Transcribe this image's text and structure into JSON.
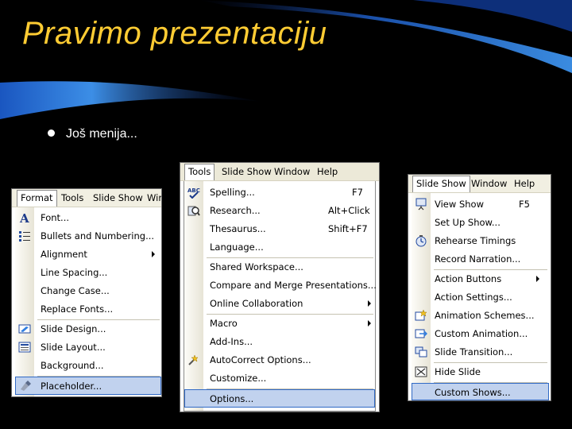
{
  "slide": {
    "title": "Pravimo prezentaciju",
    "bullet": "Još menija..."
  },
  "format_menu": {
    "menubar": [
      "Format",
      "Tools",
      "Slide Show",
      "Win"
    ],
    "items": [
      {
        "label": "Font...",
        "icon": "font-icon"
      },
      {
        "label": "Bullets and Numbering...",
        "icon": "bullets-icon"
      },
      {
        "label": "Alignment",
        "submenu": true
      },
      {
        "label": "Line Spacing..."
      },
      {
        "label": "Change Case..."
      },
      {
        "label": "Replace Fonts..."
      },
      {
        "label": "Slide Design...",
        "icon": "slide-design-icon"
      },
      {
        "label": "Slide Layout...",
        "icon": "slide-layout-icon"
      },
      {
        "label": "Background..."
      },
      {
        "label": "Placeholder...",
        "icon": "placeholder-icon",
        "highlighted": true
      }
    ]
  },
  "tools_menu": {
    "menubar": [
      "Tools",
      "Slide Show",
      "Window",
      "Help"
    ],
    "items": [
      {
        "label": "Spelling...",
        "shortcut": "F7",
        "icon": "spelling-icon"
      },
      {
        "label": "Research...",
        "shortcut": "Alt+Click",
        "icon": "research-icon"
      },
      {
        "label": "Thesaurus...",
        "shortcut": "Shift+F7"
      },
      {
        "label": "Language..."
      },
      {
        "label": "Shared Workspace..."
      },
      {
        "label": "Compare and Merge Presentations..."
      },
      {
        "label": "Online Collaboration",
        "submenu": true
      },
      {
        "label": "Macro",
        "submenu": true
      },
      {
        "label": "Add-Ins..."
      },
      {
        "label": "AutoCorrect Options...",
        "icon": "autocorrect-icon"
      },
      {
        "label": "Customize..."
      },
      {
        "label": "Options...",
        "highlighted": true
      }
    ]
  },
  "slideshow_menu": {
    "menubar": [
      "Slide Show",
      "Window",
      "Help"
    ],
    "items": [
      {
        "label": "View Show",
        "shortcut": "F5",
        "icon": "view-show-icon"
      },
      {
        "label": "Set Up Show..."
      },
      {
        "label": "Rehearse Timings",
        "icon": "rehearse-icon"
      },
      {
        "label": "Record Narration..."
      },
      {
        "label": "Action Buttons",
        "submenu": true
      },
      {
        "label": "Action Settings..."
      },
      {
        "label": "Animation Schemes...",
        "icon": "animation-schemes-icon"
      },
      {
        "label": "Custom Animation...",
        "icon": "custom-animation-icon"
      },
      {
        "label": "Slide Transition...",
        "icon": "slide-transition-icon"
      },
      {
        "label": "Hide Slide",
        "icon": "hide-slide-icon"
      },
      {
        "label": "Custom Shows...",
        "highlighted": true
      }
    ]
  },
  "colors": {
    "title": "#ffcc33",
    "highlight_fill": "#c1d2ee",
    "highlight_border": "#316ac5",
    "menubar_bg": "#f1efe2"
  }
}
